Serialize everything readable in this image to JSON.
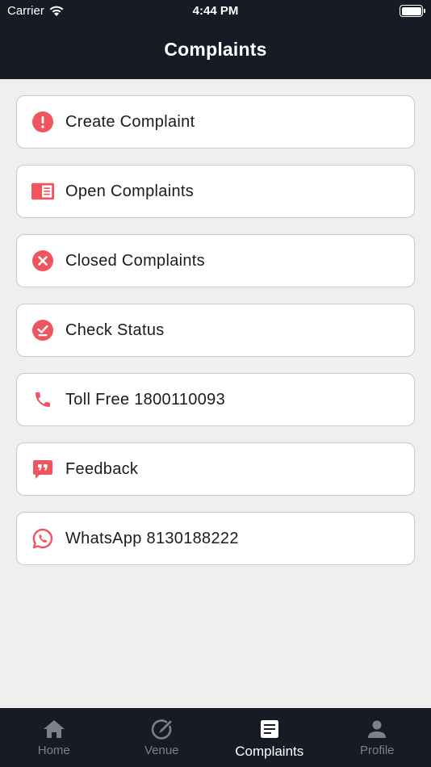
{
  "status_bar": {
    "carrier": "Carrier",
    "time": "4:44 PM"
  },
  "header": {
    "title": "Complaints"
  },
  "menu": {
    "items": [
      {
        "label": "Create Complaint",
        "icon": "alert-circle-icon"
      },
      {
        "label": "Open Complaints",
        "icon": "open-list-icon"
      },
      {
        "label": "Closed Complaints",
        "icon": "close-circle-icon"
      },
      {
        "label": "Check Status",
        "icon": "check-circle-icon"
      },
      {
        "label": "Toll Free 1800110093",
        "icon": "phone-icon"
      },
      {
        "label": "Feedback",
        "icon": "feedback-quote-icon"
      },
      {
        "label": "WhatsApp 8130188222",
        "icon": "whatsapp-icon"
      }
    ]
  },
  "tabbar": {
    "tabs": [
      {
        "label": "Home",
        "icon": "home-icon",
        "active": false
      },
      {
        "label": "Venue",
        "icon": "edit-circle-icon",
        "active": false
      },
      {
        "label": "Complaints",
        "icon": "document-icon",
        "active": true
      },
      {
        "label": "Profile",
        "icon": "person-icon",
        "active": false
      }
    ]
  },
  "colors": {
    "header_bg": "#161b25",
    "accent": "#f0555f",
    "page_bg": "#efefef",
    "tab_inactive": "#7d8089",
    "tab_active": "#ffffff"
  }
}
